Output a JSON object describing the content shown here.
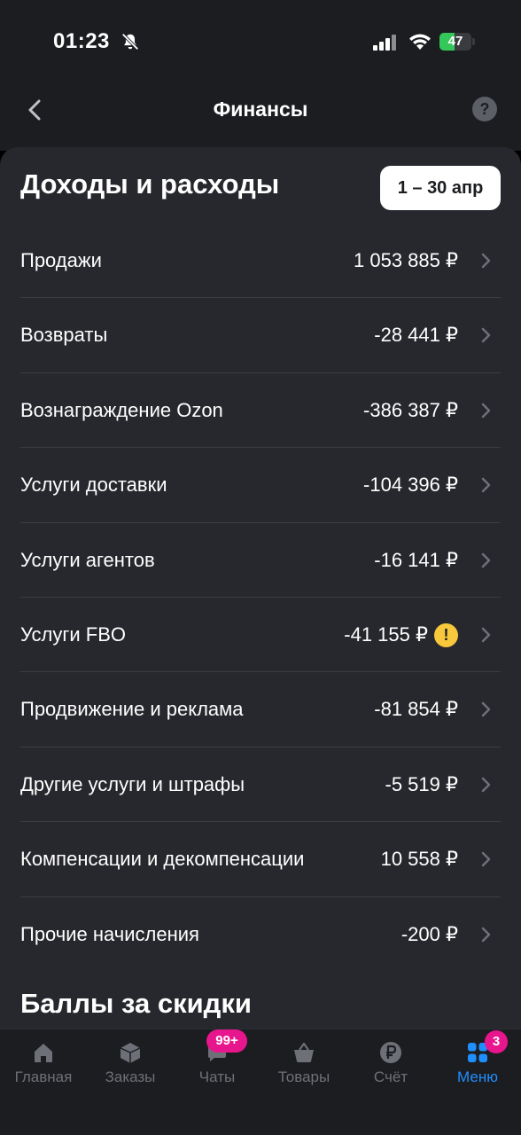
{
  "status_bar": {
    "time": "01:23",
    "battery": "47",
    "battery_level": 0.47
  },
  "nav": {
    "title": "Финансы",
    "help_label": "?"
  },
  "header": {
    "title": "Доходы и расходы",
    "period": "1 – 30 апр"
  },
  "rows": [
    {
      "label": "Продажи",
      "value": "1 053 885 ₽"
    },
    {
      "label": "Возвраты",
      "value": "-28 441 ₽"
    },
    {
      "label": "Вознаграждение Ozon",
      "value": "-386 387 ₽"
    },
    {
      "label": "Услуги доставки",
      "value": "-104 396 ₽"
    },
    {
      "label": "Услуги агентов",
      "value": "-16 141 ₽"
    },
    {
      "label": "Услуги FBO",
      "value": "-41 155 ₽",
      "warning": "!"
    },
    {
      "label": "Продвижение и реклама",
      "value": "-81 854 ₽"
    },
    {
      "label": "Другие услуги и штрафы",
      "value": "-5 519 ₽"
    },
    {
      "label": "Компенсации и декомпенсации",
      "value": "10 558 ₽"
    },
    {
      "label": "Прочие начисления",
      "value": "-200 ₽"
    }
  ],
  "section2": {
    "title": "Баллы за скидки"
  },
  "tabbar": {
    "active_color": "#1f8fff",
    "badge_color": "#e8168d",
    "tabs": [
      {
        "label": "Главная",
        "icon": "home-icon"
      },
      {
        "label": "Заказы",
        "icon": "box-icon"
      },
      {
        "label": "Чаты",
        "icon": "chat-icon",
        "badge": "99+"
      },
      {
        "label": "Товары",
        "icon": "basket-icon"
      },
      {
        "label": "Счёт",
        "icon": "ruble-icon"
      },
      {
        "label": "Меню",
        "icon": "grid-icon",
        "badge": "3",
        "active": true
      }
    ]
  }
}
